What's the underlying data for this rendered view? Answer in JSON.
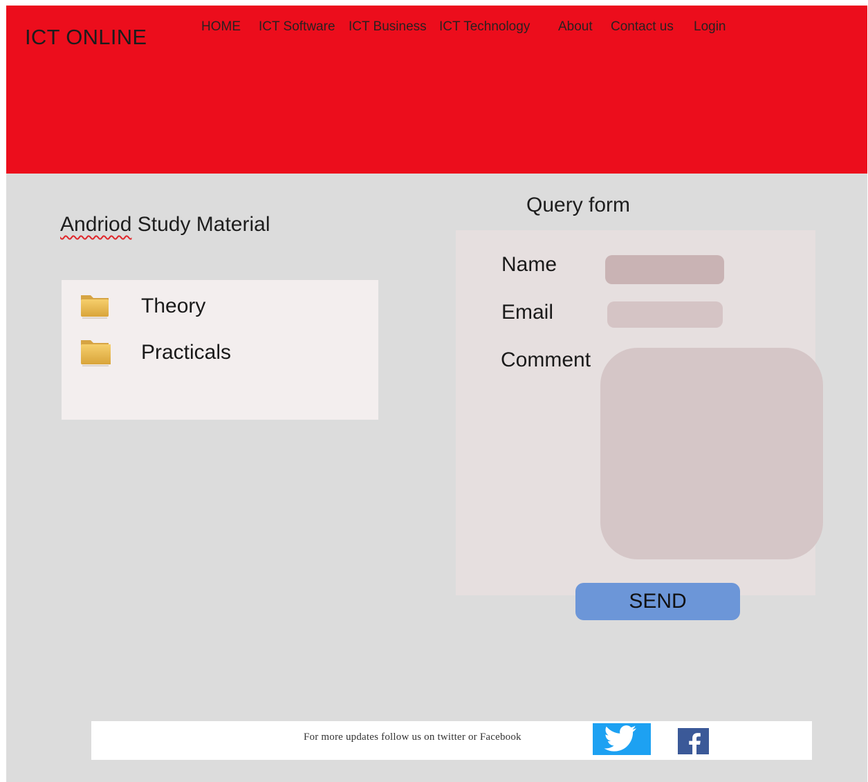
{
  "brand": {
    "name": "ICT ONLINE",
    "header_color": "#ec0d1c"
  },
  "nav": {
    "items": [
      {
        "label": "HOME"
      },
      {
        "label": "ICT Software"
      },
      {
        "label": "ICT Business"
      },
      {
        "label": "ICT Technology"
      },
      {
        "label": "About"
      },
      {
        "label": "Contact us"
      },
      {
        "label": "Login"
      }
    ]
  },
  "study": {
    "title_misspelled": "Andriod",
    "title_rest": " Study Material",
    "items": [
      {
        "label": "Theory",
        "icon": "folder-icon"
      },
      {
        "label": "Practicals",
        "icon": "folder-icon"
      }
    ]
  },
  "query_form": {
    "title": "Query form",
    "name_label": "Name",
    "email_label": "Email",
    "comment_label": "Comment",
    "name_value": "",
    "email_value": "",
    "comment_value": "",
    "send_label": "SEND",
    "send_color": "#6c96d8"
  },
  "footer": {
    "text": "For more updates follow us on twitter or Facebook",
    "twitter_color": "#1da1f2",
    "facebook_color": "#3b5998"
  }
}
